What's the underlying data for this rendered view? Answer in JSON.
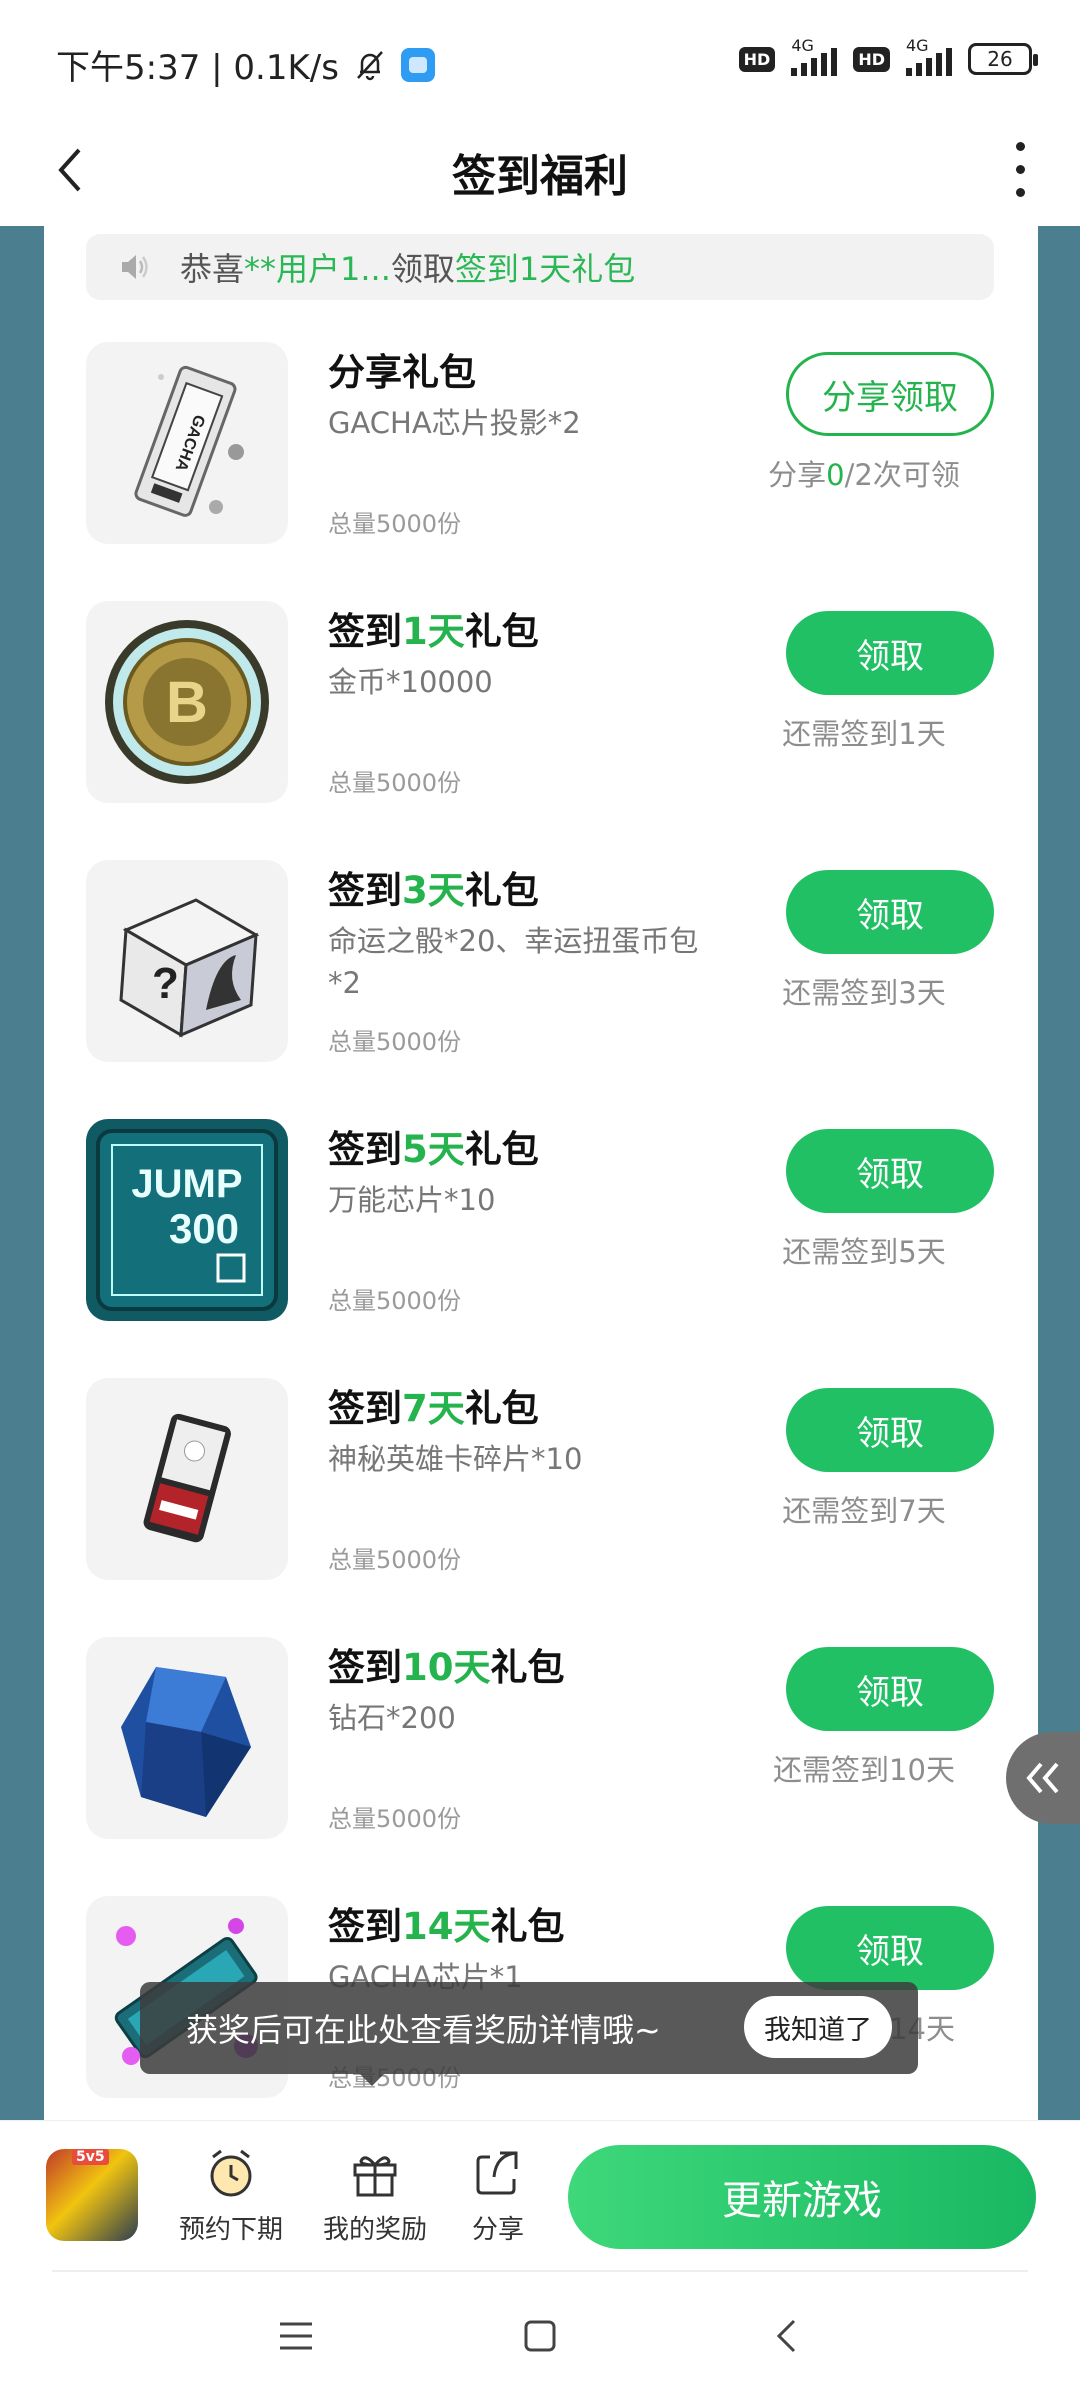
{
  "status_bar": {
    "time_speed": "下午5:37 | 0.1K/s",
    "hd1": "HD",
    "net1": "4G",
    "hd2": "HD",
    "net2": "4G",
    "battery": "26"
  },
  "header": {
    "title": "签到福利"
  },
  "notice": {
    "prefix": "恭喜",
    "user": "**用户1...",
    "middle": "领取",
    "gift": "签到1天礼包"
  },
  "items": [
    {
      "title_pre": "分享礼包",
      "title_num": "",
      "title_post": "",
      "desc": "GACHA芯片投影*2",
      "total": "总量5000份",
      "button": "分享领取",
      "hint_pre": "分享",
      "hint_num": "0",
      "hint_post": "/2次可领",
      "image": "gacha-chip-projection"
    },
    {
      "title_pre": "签到",
      "title_num": "1天",
      "title_post": "礼包",
      "desc": "金币*10000",
      "total": "总量5000份",
      "button": "领取",
      "hint": "还需签到1天",
      "image": "gold-coin"
    },
    {
      "title_pre": "签到",
      "title_num": "3天",
      "title_post": "礼包",
      "desc": "命运之骰*20、幸运扭蛋币包*2",
      "total": "总量5000份",
      "button": "领取",
      "hint": "还需签到3天",
      "image": "fate-dice"
    },
    {
      "title_pre": "签到",
      "title_num": "5天",
      "title_post": "礼包",
      "desc": "万能芯片*10",
      "total": "总量5000份",
      "button": "领取",
      "hint": "还需签到5天",
      "image": "jump-300-chip",
      "image_text_1": "JUMP",
      "image_text_2": "300"
    },
    {
      "title_pre": "签到",
      "title_num": "7天",
      "title_post": "礼包",
      "desc": "神秘英雄卡碎片*10",
      "total": "总量5000份",
      "button": "领取",
      "hint": "还需签到7天",
      "image": "hero-card-fragment"
    },
    {
      "title_pre": "签到",
      "title_num": "10天",
      "title_post": "礼包",
      "desc": "钻石*200",
      "total": "总量5000份",
      "button": "领取",
      "hint": "还需签到10天",
      "image": "diamond"
    },
    {
      "title_pre": "签到",
      "title_num": "14天",
      "title_post": "礼包",
      "desc": "GACHA芯片*1",
      "total": "总量5000份",
      "button": "领取",
      "hint": "还需签到14天",
      "image": "gacha-chip"
    }
  ],
  "tooltip": {
    "text": "获奖后可在此处查看奖励详情哦~",
    "button": "我知道了"
  },
  "bottom_bar": {
    "game_badge": "5v5",
    "reserve": "预约下期",
    "rewards": "我的奖励",
    "share": "分享",
    "update": "更新游戏"
  },
  "colors": {
    "accent": "#21c065",
    "frame": "#4b7f8f"
  }
}
